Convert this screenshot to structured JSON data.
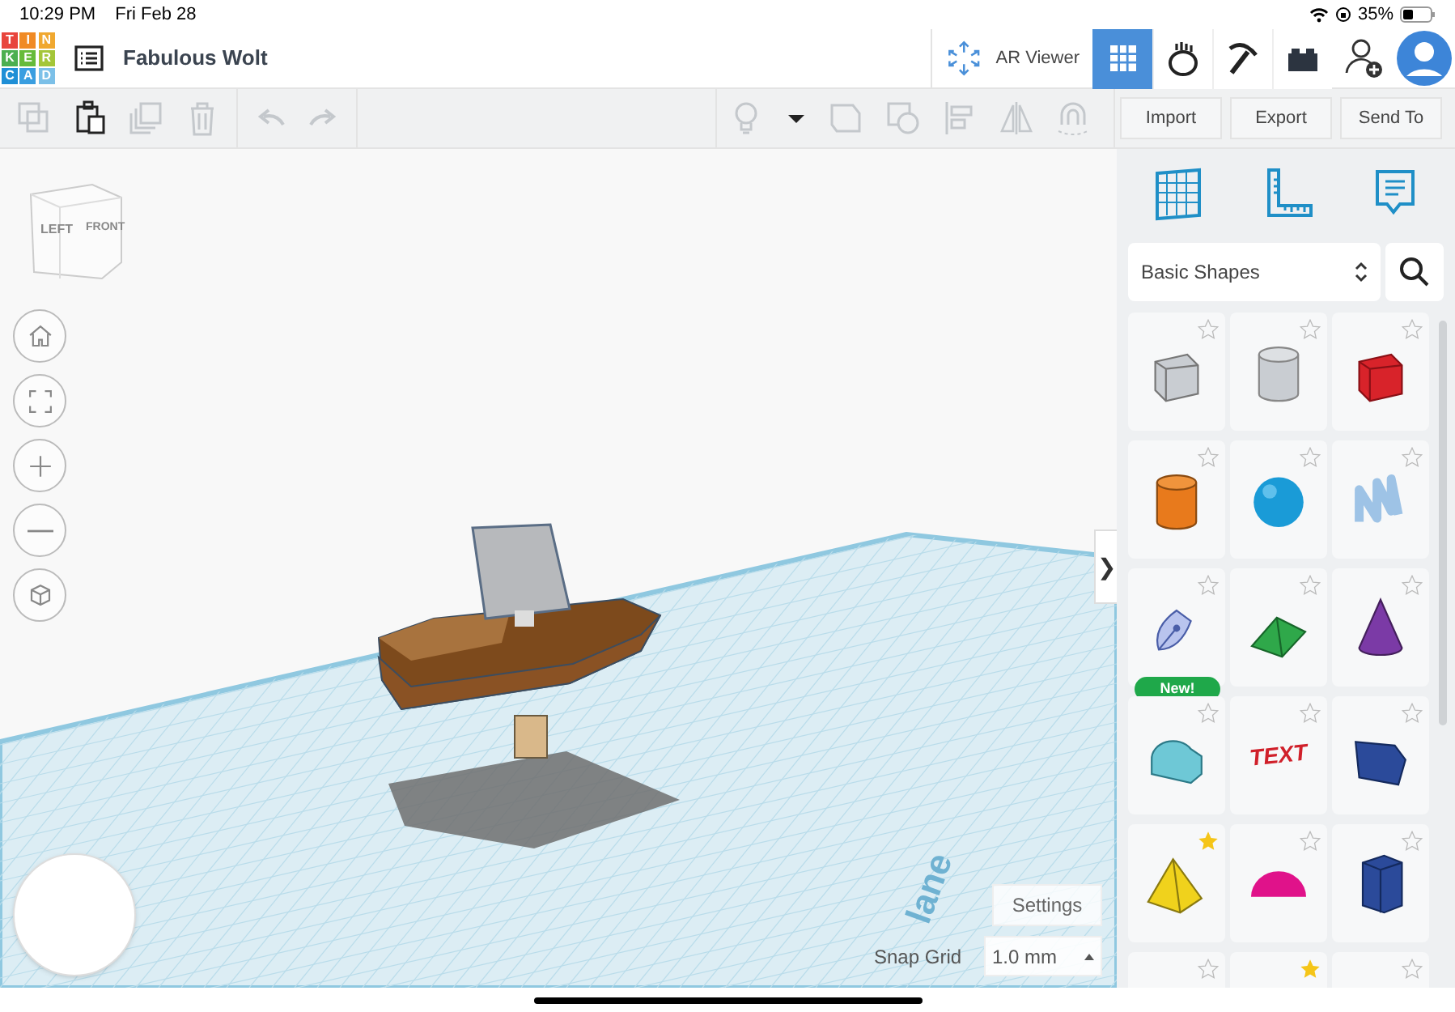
{
  "status_bar": {
    "time": "10:29 PM",
    "date": "Fri Feb 28",
    "battery": "35%"
  },
  "header": {
    "logo": [
      {
        "letter": "T",
        "color": "#e8453c"
      },
      {
        "letter": "I",
        "color": "#f08a24"
      },
      {
        "letter": "N",
        "color": "#f0a830"
      },
      {
        "letter": "K",
        "color": "#4caf50"
      },
      {
        "letter": "E",
        "color": "#66bb3a"
      },
      {
        "letter": "R",
        "color": "#a4c639"
      },
      {
        "letter": "C",
        "color": "#1f8fd6"
      },
      {
        "letter": "A",
        "color": "#3a9ee0"
      },
      {
        "letter": "D",
        "color": "#7cc0e8"
      }
    ],
    "title": "Fabulous Wolt",
    "ar_viewer": "AR Viewer",
    "views": [
      {
        "kind": "grid",
        "selected": true
      },
      {
        "kind": "blocks",
        "selected": false
      },
      {
        "kind": "pickaxe",
        "selected": false
      },
      {
        "kind": "brick",
        "selected": false
      }
    ]
  },
  "toolbar": {
    "edit_tools": [
      {
        "kind": "copy",
        "disabled": true
      },
      {
        "kind": "paste",
        "disabled": false
      },
      {
        "kind": "duplicate",
        "disabled": true
      },
      {
        "kind": "delete",
        "disabled": true
      }
    ],
    "history_tools": [
      {
        "kind": "undo",
        "disabled": true
      },
      {
        "kind": "redo",
        "disabled": true
      }
    ],
    "shape_tools": [
      {
        "kind": "light",
        "disabled": true
      },
      {
        "kind": "caret",
        "disabled": false
      },
      {
        "kind": "group",
        "disabled": true
      },
      {
        "kind": "ungroup",
        "disabled": true
      },
      {
        "kind": "align",
        "disabled": true
      },
      {
        "kind": "mirror",
        "disabled": true
      },
      {
        "kind": "magnet",
        "disabled": true
      }
    ],
    "buttons": [
      "Import",
      "Export",
      "Send To"
    ]
  },
  "canvas": {
    "view_cube": {
      "left": "LEFT",
      "front": "FRONT"
    },
    "nav": [
      {
        "kind": "home"
      },
      {
        "kind": "fit"
      },
      {
        "kind": "zoom-in"
      },
      {
        "kind": "zoom-out"
      },
      {
        "kind": "view"
      }
    ],
    "workplane_label": "lane",
    "settings": "Settings",
    "snap_grid": {
      "label": "Snap Grid",
      "value": "1.0 mm"
    }
  },
  "panel": {
    "collapse": "❯",
    "tools": [
      {
        "kind": "workplane"
      },
      {
        "kind": "ruler"
      },
      {
        "kind": "notes"
      }
    ],
    "category": "Basic Shapes",
    "shapes": [
      {
        "kind": "box-hole",
        "starred": false
      },
      {
        "kind": "cylinder-hole",
        "starred": false
      },
      {
        "kind": "box",
        "starred": false
      },
      {
        "kind": "cylinder",
        "starred": false
      },
      {
        "kind": "sphere",
        "starred": false
      },
      {
        "kind": "scribble",
        "starred": false
      },
      {
        "kind": "pen",
        "starred": false,
        "badge": "New!"
      },
      {
        "kind": "roof",
        "starred": false
      },
      {
        "kind": "cone",
        "starred": false
      },
      {
        "kind": "round-roof",
        "starred": false
      },
      {
        "kind": "text",
        "starred": false,
        "label": "TEXT"
      },
      {
        "kind": "wedge-box",
        "starred": false
      },
      {
        "kind": "pyramid",
        "starred": true
      },
      {
        "kind": "half-sphere",
        "starred": false
      },
      {
        "kind": "polygon",
        "starred": false
      },
      {
        "kind": "cut",
        "starred": false
      },
      {
        "kind": "cut",
        "starred": true
      },
      {
        "kind": "cut",
        "starred": false
      }
    ]
  }
}
